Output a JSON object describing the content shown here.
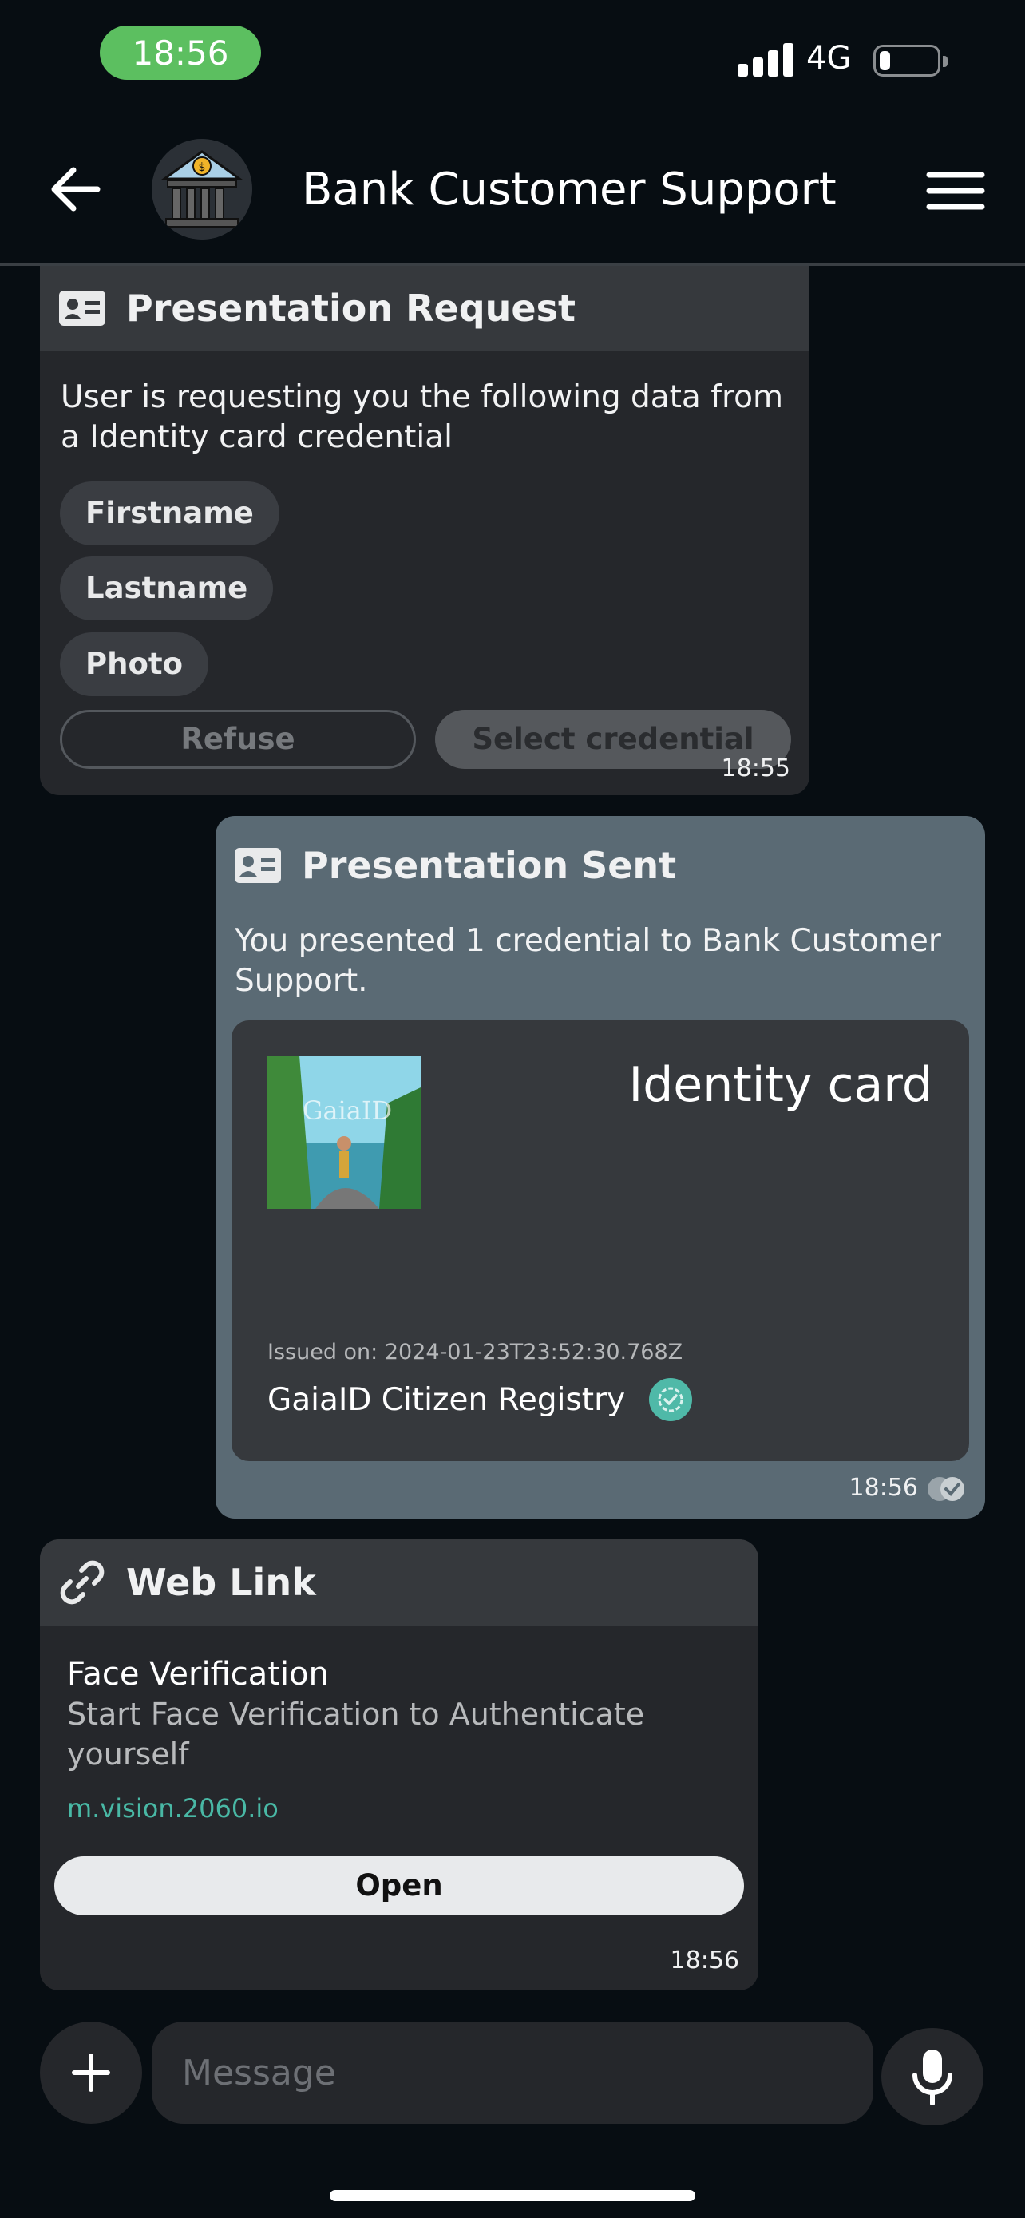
{
  "status_bar": {
    "time": "18:56",
    "network": "4G",
    "battery_level": 0.18
  },
  "header": {
    "title": "Bank Customer Support"
  },
  "messages": {
    "request": {
      "title": "Presentation Request",
      "text": "User is requesting you the following data from a Identity card credential",
      "fields": [
        "Firstname",
        "Lastname",
        "Photo"
      ],
      "refuse_label": "Refuse",
      "select_label": "Select credential",
      "time": "18:55"
    },
    "sent": {
      "title": "Presentation Sent",
      "text": "You presented 1 credential to Bank Customer Support.",
      "credential": {
        "title": "Identity card",
        "image_text": "GaiaID",
        "issued": "Issued on: 2024-01-23T23:52:30.768Z",
        "issuer": "GaiaID Citizen Registry"
      },
      "time": "18:56"
    },
    "web_link": {
      "title": "Web Link",
      "link_title": "Face Verification",
      "description": "Start Face Verification to Authenticate yourself",
      "url": "m.vision.2060.io",
      "open_label": "Open",
      "time": "18:56"
    }
  },
  "composer": {
    "placeholder": "Message"
  },
  "colors": {
    "accent": "#49b8a5",
    "sent_bubble": "#5a6a74",
    "received_bubble": "#25272b",
    "status_green": "#5cbf60"
  },
  "icons": [
    "back-arrow-icon",
    "bank-avatar-icon",
    "menu-icon",
    "id-card-icon",
    "link-icon",
    "verified-badge-icon",
    "read-check-icon",
    "plus-icon",
    "mic-icon"
  ]
}
